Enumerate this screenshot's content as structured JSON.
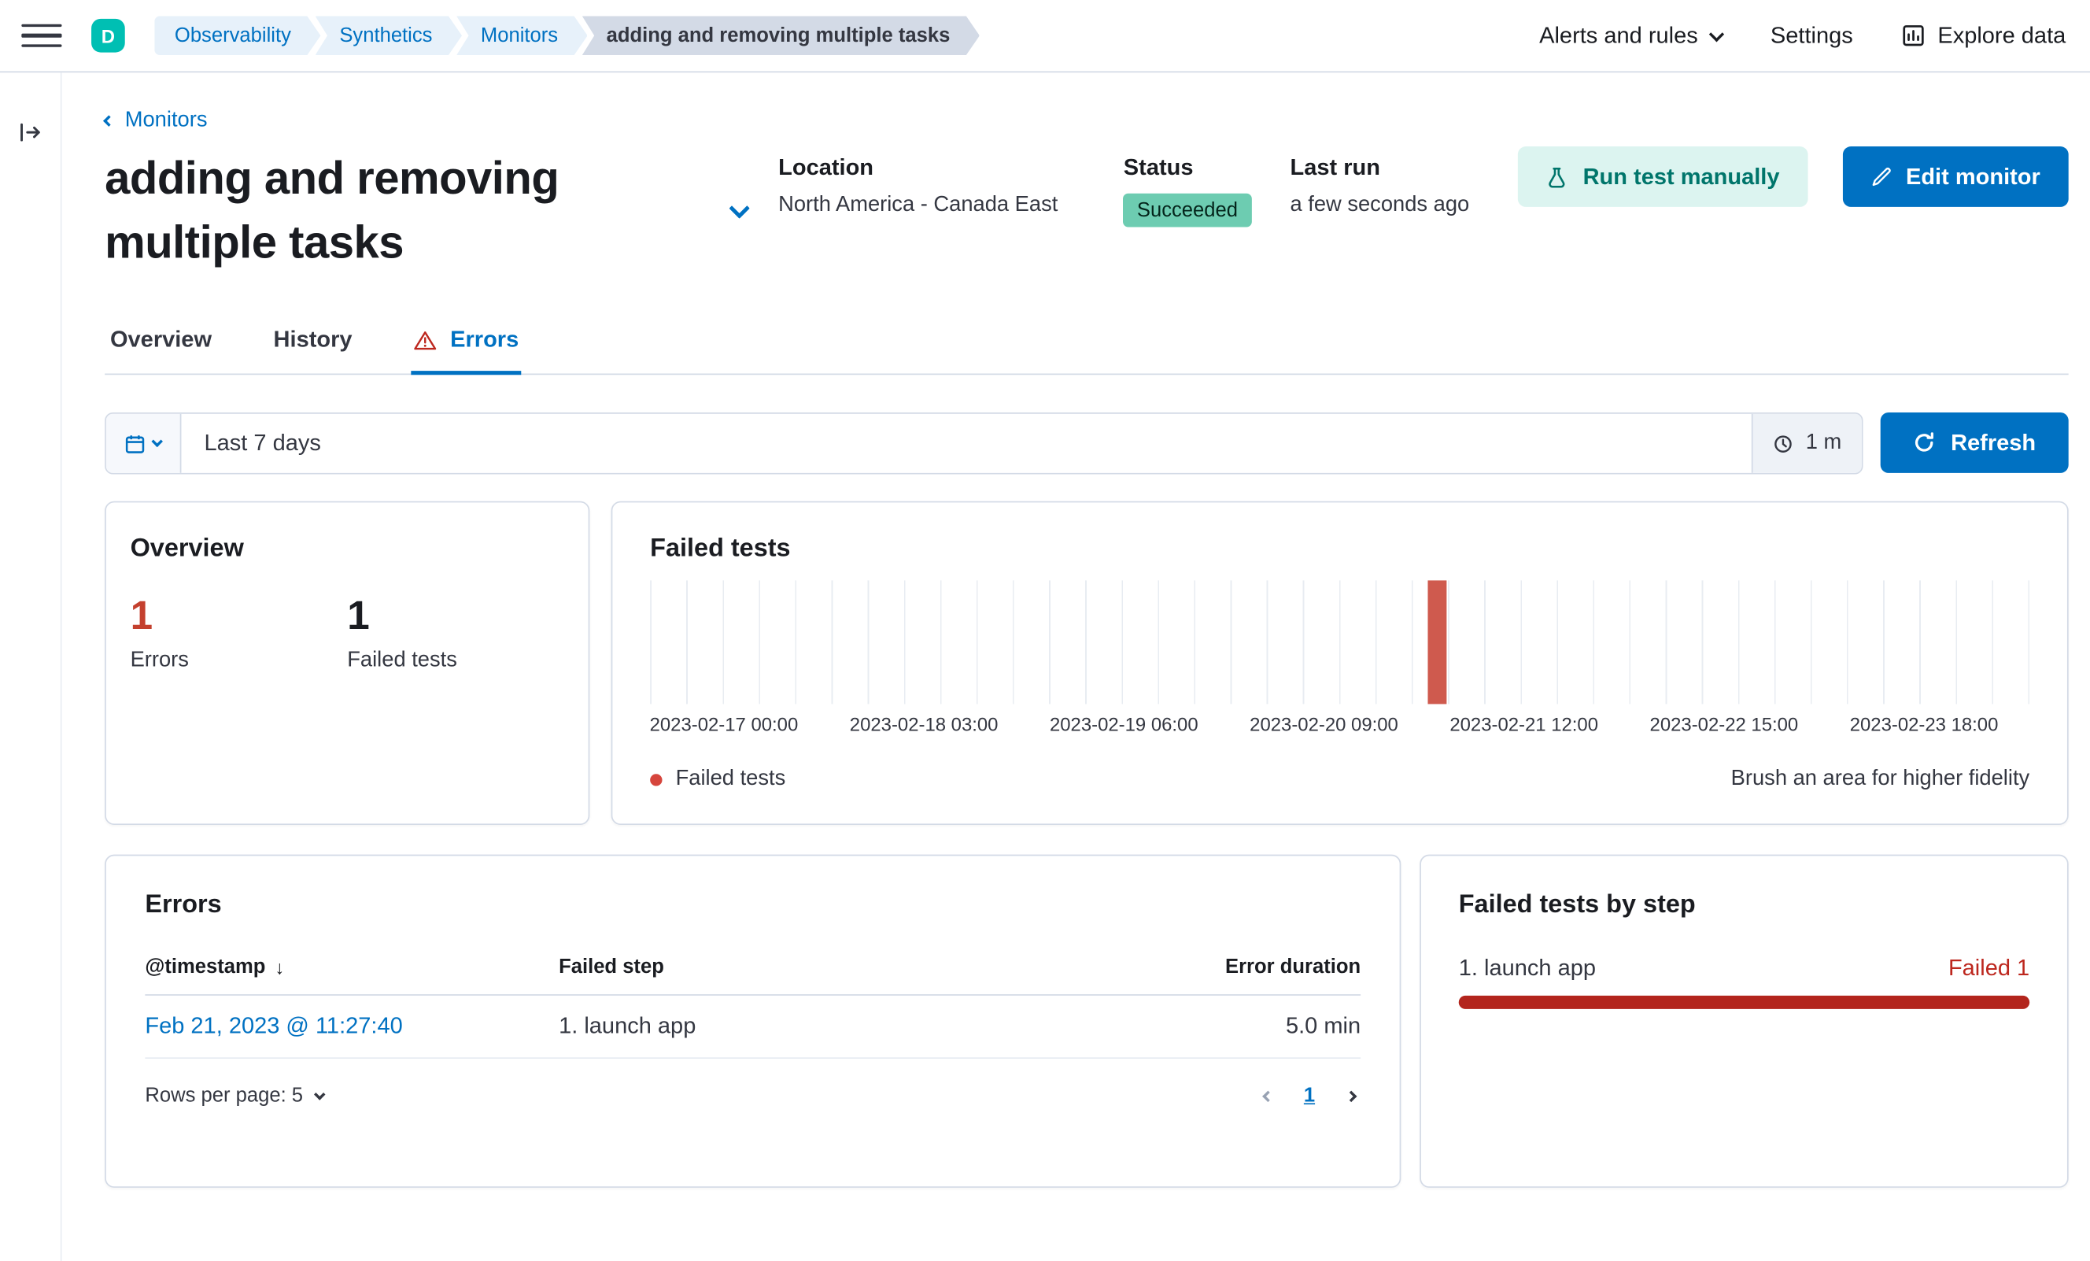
{
  "colors": {
    "primary": "#0071c2",
    "danger": "#bd271e",
    "accent_teal": "#00bfb3",
    "success_badge": "#6dccb1",
    "errors_count": "#c4402e",
    "chart_bar": "#cf5a4e",
    "step_bar": "#b3251d"
  },
  "header": {
    "avatar_initial": "D",
    "breadcrumbs": [
      "Observability",
      "Synthetics",
      "Monitors",
      "adding and removing multiple tasks"
    ],
    "alerts_menu": "Alerts and rules",
    "settings": "Settings",
    "explore_data": "Explore data"
  },
  "monitor": {
    "back_link": "Monitors",
    "title": "adding and removing multiple tasks",
    "location_label": "Location",
    "location_value": "North America - Canada East",
    "status_label": "Status",
    "status_value": "Succeeded",
    "last_run_label": "Last run",
    "last_run_value": "a few seconds ago",
    "run_test_button": "Run test manually",
    "edit_button": "Edit monitor"
  },
  "tabs": {
    "overview": "Overview",
    "history": "History",
    "errors": "Errors"
  },
  "time_controls": {
    "range": "Last 7 days",
    "refresh_interval": "1 m",
    "refresh_button": "Refresh"
  },
  "overview_card": {
    "title": "Overview",
    "errors_value": "1",
    "errors_label": "Errors",
    "failed_value": "1",
    "failed_label": "Failed tests"
  },
  "chart_data": {
    "type": "bar",
    "title": "Failed tests",
    "x_ticks": [
      "2023-02-17 00:00",
      "2023-02-18 03:00",
      "2023-02-19 06:00",
      "2023-02-20 09:00",
      "2023-02-21 12:00",
      "2023-02-22 15:00",
      "2023-02-23 18:00"
    ],
    "series": [
      {
        "name": "Failed tests",
        "points": [
          {
            "x": "2023-02-21 ~01:00",
            "y": 1
          }
        ]
      }
    ],
    "ylim": [
      0,
      1
    ],
    "grid": "vertical-only",
    "legend": [
      {
        "label": "Failed tests",
        "color": "#d6453c"
      }
    ],
    "hint": "Brush an area for higher fidelity"
  },
  "errors_card": {
    "title": "Errors",
    "columns": {
      "timestamp": "@timestamp",
      "step": "Failed step",
      "duration": "Error duration"
    },
    "sort_arrow": "↓",
    "rows": [
      {
        "timestamp": "Feb 21, 2023 @ 11:27:40",
        "step": "1. launch app",
        "duration": "5.0 min"
      }
    ],
    "rows_per_page": "Rows per page: 5",
    "page": "1"
  },
  "by_step_card": {
    "title": "Failed tests by step",
    "steps": [
      {
        "label": "1. launch app",
        "result": "Failed 1",
        "pct": 100
      }
    ]
  }
}
